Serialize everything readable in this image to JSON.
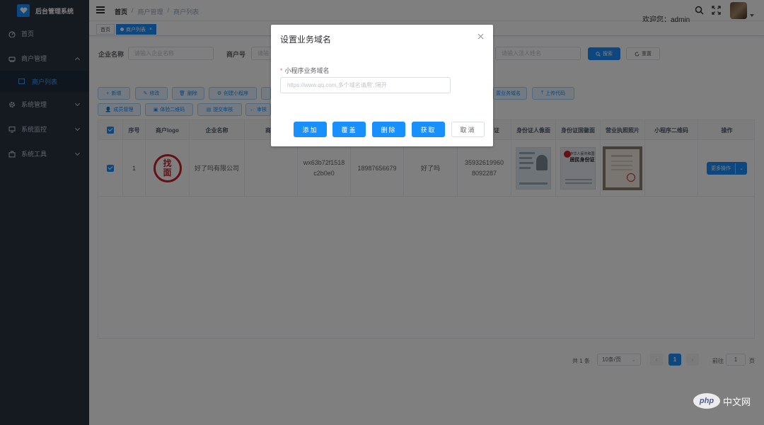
{
  "app": {
    "title": "后台管理系统"
  },
  "sidebar": {
    "items": [
      {
        "label": "首页",
        "icon": "dashboard-icon"
      },
      {
        "label": "商户管理",
        "icon": "store-icon",
        "expanded": true,
        "children": [
          {
            "label": "商户列表",
            "active": true
          }
        ]
      },
      {
        "label": "系统管理",
        "icon": "gear-icon"
      },
      {
        "label": "系统监控",
        "icon": "monitor-icon"
      },
      {
        "label": "系统工具",
        "icon": "toolbox-icon"
      }
    ]
  },
  "topbar": {
    "breadcrumb": [
      "首页",
      "/",
      "商户管理",
      "/",
      "商户列表"
    ],
    "welcome": "欢迎您：admin"
  },
  "tags": {
    "home": "首页",
    "active": "商户列表",
    "close": "×"
  },
  "search": {
    "company_label": "企业名称",
    "company_placeholder": "请输入企业名称",
    "merchant_label": "商户号",
    "merchant_placeholder": "请输",
    "legal_placeholder": "请输入法人姓名",
    "search_btn": "搜索",
    "reset_btn": "重置"
  },
  "toolbar": {
    "add": "新增",
    "edit": "修改",
    "delete": "删除",
    "create_mini": "创建小程序",
    "set_domain": "置业务域名",
    "upload_code": "上传代码",
    "members": "成员管理",
    "trial_qr": "体验二维码",
    "submit_review": "提交审核",
    "review": "审核"
  },
  "table": {
    "headers": {
      "index": "序号",
      "logo": "商户logo",
      "company": "企业名称",
      "merchant": "商户",
      "cert": "证",
      "id_front": "身份证人像面",
      "id_back": "身份证国徽面",
      "license": "营业执照照片",
      "mini_qr": "小程序二维码",
      "actions": "操作"
    },
    "rows": [
      {
        "index": "1",
        "logo_text_1": "找",
        "logo_text_2": "面",
        "company": "好了吗有限公司",
        "appid_1": "wx63b72f1518",
        "appid_2": "c2b0e0",
        "phone": "18987656679",
        "name": "好了吗",
        "cert_1": "35932619960",
        "cert_2": "8092287",
        "id_back_title": "中华人民共和国",
        "id_back_sub": "居民身份证",
        "more_btn": "更多操作"
      }
    ]
  },
  "pagination": {
    "total": "共 1 条",
    "page_size": "10条/页",
    "current": "1",
    "goto_label": "前往",
    "goto_value": "1",
    "page_unit": "页"
  },
  "dialog": {
    "title": "设置业务域名",
    "required_mark": "*",
    "field_label": "小程序业务域名",
    "placeholder": "https://www.qq.com,多个域名请用','隔开",
    "buttons": {
      "add": "添加",
      "cover": "覆盖",
      "delete": "删除",
      "fetch": "获取",
      "cancel": "取消"
    }
  },
  "watermark": {
    "brand": "php",
    "site": "中文网"
  },
  "colors": {
    "primary": "#1890ff",
    "sidebar": "#2b3442",
    "danger": "#f56c6c"
  }
}
